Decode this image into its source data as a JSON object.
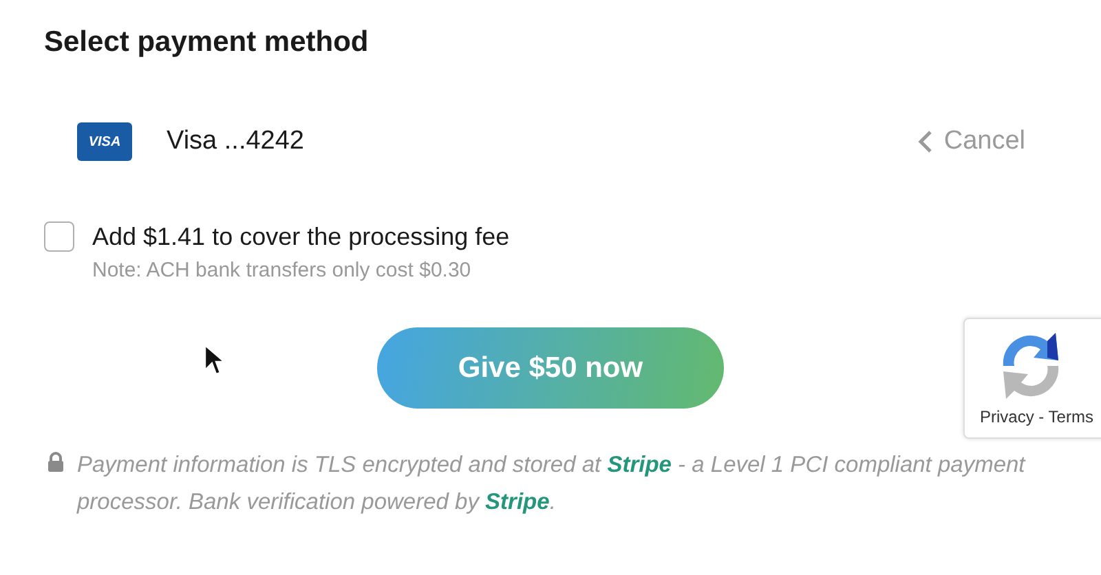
{
  "heading": "Select payment method",
  "card": {
    "brand": "VISA",
    "label": "Visa ...4242",
    "cancel": "Cancel"
  },
  "fee": {
    "label": "Add $1.41 to cover the processing fee",
    "checked": false,
    "note": "Note: ACH bank transfers only cost $0.30"
  },
  "submit": "Give $50 now",
  "captcha": {
    "links": "Privacy - Terms"
  },
  "notice": [
    {
      "kind": "text",
      "text": "Payment information is TLS encrypted and stored at "
    },
    {
      "kind": "link",
      "text": "Stripe"
    },
    {
      "kind": "text",
      "text": " - a Level 1 PCI compliant payment processor. Bank verification powered by "
    },
    {
      "kind": "link",
      "text": "Stripe"
    },
    {
      "kind": "text",
      "text": "."
    }
  ]
}
